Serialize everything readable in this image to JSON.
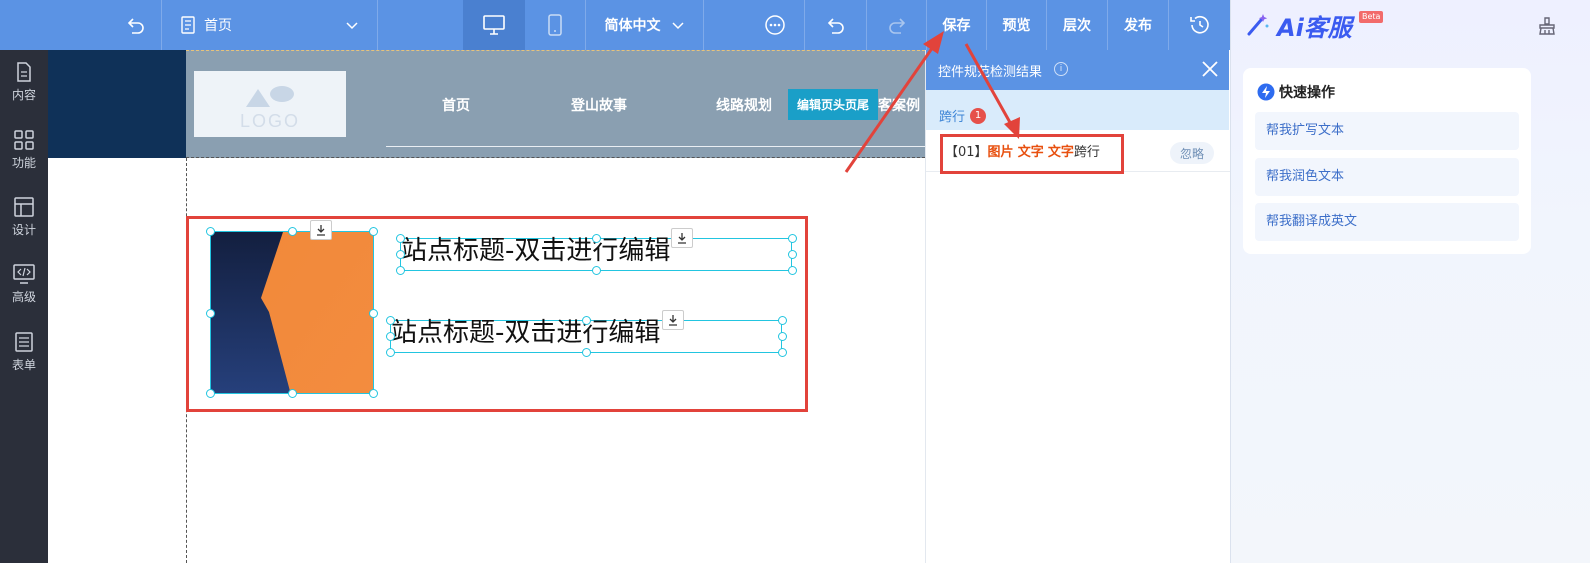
{
  "toolbar": {
    "page_select": "首页",
    "language_select": "简体中文",
    "save_label": "保存",
    "preview_label": "预览",
    "layers_label": "层次",
    "publish_label": "发布"
  },
  "sidebar": {
    "items": [
      {
        "label": "内容",
        "icon": "document-icon"
      },
      {
        "label": "功能",
        "icon": "grid-icon"
      },
      {
        "label": "设计",
        "icon": "layout-icon"
      },
      {
        "label": "高级",
        "icon": "code-icon"
      },
      {
        "label": "表单",
        "icon": "list-icon"
      }
    ]
  },
  "canvas": {
    "logo_text": "LOGO",
    "nav": [
      "首页",
      "登山故事",
      "线路规划",
      "客案例"
    ],
    "edit_header_footer": "编辑页头页尾",
    "title_1": "站点标题-双击进行编辑",
    "title_2": "站点标题-双击进行编辑"
  },
  "check_panel": {
    "title": "控件规范检测结果",
    "info": "i",
    "tab_label": "跨行",
    "tab_count": "1",
    "result": {
      "index": "【01】",
      "tokens": [
        "图片",
        "文字",
        "文字"
      ],
      "suffix": "跨行",
      "ignore_label": "忽略"
    }
  },
  "ai_panel": {
    "title": "Ai客服",
    "beta": "Beta",
    "quick_title": "快速操作",
    "actions": [
      "帮我扩写文本",
      "帮我润色文本",
      "帮我翻译成英文"
    ]
  },
  "colors": {
    "toolbar_blue": "#5b93e4",
    "sidebar_dark": "#2b2f3a",
    "highlight_red": "#e2433b",
    "selection_cyan": "#22c5e0",
    "ai_blue": "#3b5bf0"
  }
}
